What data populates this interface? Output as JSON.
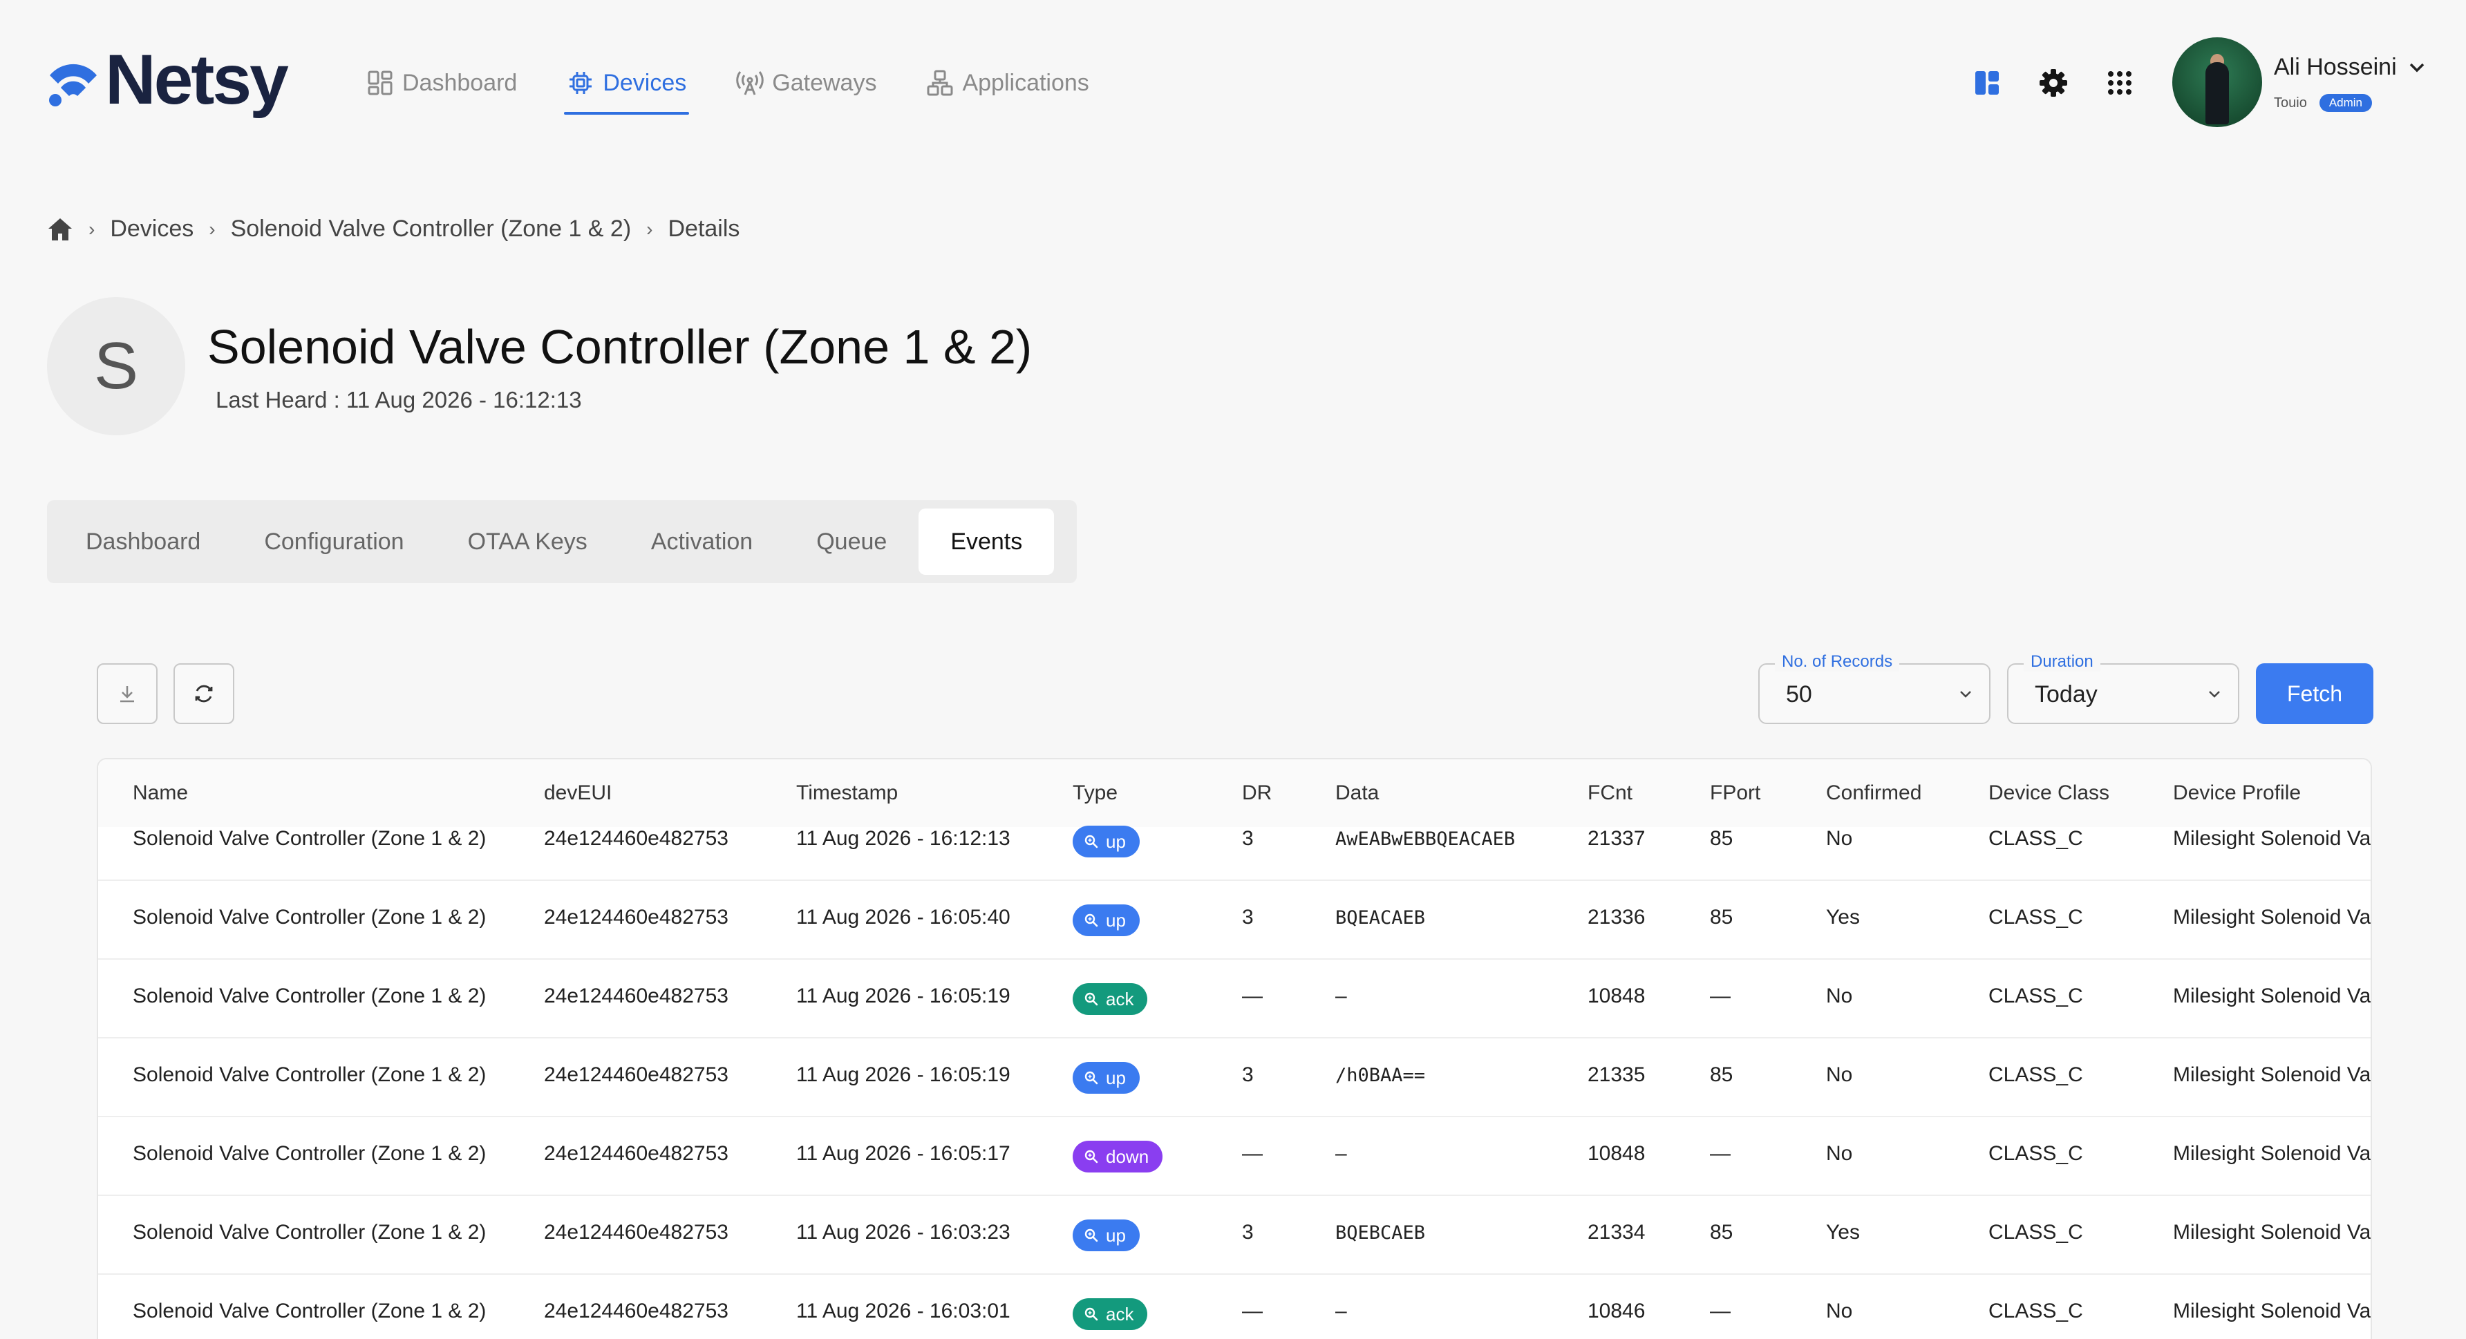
{
  "brand": {
    "name": "Netsy"
  },
  "nav": [
    {
      "label": "Dashboard",
      "icon": "grid-icon",
      "active": false
    },
    {
      "label": "Devices",
      "icon": "chip-icon",
      "active": true
    },
    {
      "label": "Gateways",
      "icon": "antenna-icon",
      "active": false
    },
    {
      "label": "Applications",
      "icon": "apps-network-icon",
      "active": false
    }
  ],
  "user": {
    "name": "Ali Hosseini",
    "org": "Touio",
    "role": "Admin"
  },
  "breadcrumb": {
    "devices": "Devices",
    "device": "Solenoid Valve Controller (Zone 1 & 2)",
    "current": "Details"
  },
  "device": {
    "initial": "S",
    "title": "Solenoid Valve Controller (Zone 1 & 2)",
    "last_heard": "Last Heard :  11 Aug 2026 - 16:12:13"
  },
  "tabs": [
    "Dashboard",
    "Configuration",
    "OTAA Keys",
    "Activation",
    "Queue",
    "Events"
  ],
  "active_tab": "Events",
  "filters": {
    "records_label": "No. of Records",
    "records_value": "50",
    "duration_label": "Duration",
    "duration_value": "Today",
    "fetch_label": "Fetch"
  },
  "colors": {
    "accent": "#3b7bf0",
    "up": "#3b7bf0",
    "ack": "#139a7d",
    "down": "#8a3ef0"
  },
  "table": {
    "headers": [
      "Name",
      "devEUI",
      "Timestamp",
      "Type",
      "DR",
      "Data",
      "FCnt",
      "FPort",
      "Confirmed",
      "Device Class",
      "Device Profile"
    ],
    "rows": [
      {
        "name": "Solenoid Valve Controller (Zone 1 & 2)",
        "deveui": "24e124460e482753",
        "timestamp": "11 Aug 2026 - 16:12:13",
        "type": "up",
        "dr": "3",
        "data": "AwEABwEBBQEACAEB",
        "fcnt": "21337",
        "fport": "85",
        "confirmed": "No",
        "class": "CLASS_C",
        "profile": "Milesight Solenoid Val"
      },
      {
        "name": "Solenoid Valve Controller (Zone 1 & 2)",
        "deveui": "24e124460e482753",
        "timestamp": "11 Aug 2026 - 16:05:40",
        "type": "up",
        "dr": "3",
        "data": "BQEACAEB",
        "fcnt": "21336",
        "fport": "85",
        "confirmed": "Yes",
        "class": "CLASS_C",
        "profile": "Milesight Solenoid Val"
      },
      {
        "name": "Solenoid Valve Controller (Zone 1 & 2)",
        "deveui": "24e124460e482753",
        "timestamp": "11 Aug 2026 - 16:05:19",
        "type": "ack",
        "dr": "—",
        "data": "–",
        "fcnt": "10848",
        "fport": "—",
        "confirmed": "No",
        "class": "CLASS_C",
        "profile": "Milesight Solenoid Val"
      },
      {
        "name": "Solenoid Valve Controller (Zone 1 & 2)",
        "deveui": "24e124460e482753",
        "timestamp": "11 Aug 2026 - 16:05:19",
        "type": "up",
        "dr": "3",
        "data": "/h0BAA==",
        "fcnt": "21335",
        "fport": "85",
        "confirmed": "No",
        "class": "CLASS_C",
        "profile": "Milesight Solenoid Val"
      },
      {
        "name": "Solenoid Valve Controller (Zone 1 & 2)",
        "deveui": "24e124460e482753",
        "timestamp": "11 Aug 2026 - 16:05:17",
        "type": "down",
        "dr": "—",
        "data": "–",
        "fcnt": "10848",
        "fport": "—",
        "confirmed": "No",
        "class": "CLASS_C",
        "profile": "Milesight Solenoid Val"
      },
      {
        "name": "Solenoid Valve Controller (Zone 1 & 2)",
        "deveui": "24e124460e482753",
        "timestamp": "11 Aug 2026 - 16:03:23",
        "type": "up",
        "dr": "3",
        "data": "BQEBCAEB",
        "fcnt": "21334",
        "fport": "85",
        "confirmed": "Yes",
        "class": "CLASS_C",
        "profile": "Milesight Solenoid Val"
      },
      {
        "name": "Solenoid Valve Controller (Zone 1 & 2)",
        "deveui": "24e124460e482753",
        "timestamp": "11 Aug 2026 - 16:03:01",
        "type": "ack",
        "dr": "—",
        "data": "–",
        "fcnt": "10846",
        "fport": "—",
        "confirmed": "No",
        "class": "CLASS_C",
        "profile": "Milesight Solenoid Val"
      }
    ]
  }
}
